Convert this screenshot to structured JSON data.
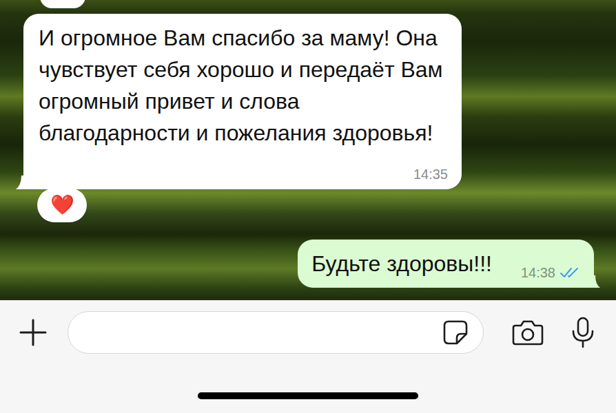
{
  "messages": [
    {
      "direction": "incoming",
      "text": "И огромное Вам спасибо за маму! Она чувствует себя хорошо и передаёт Вам огромный привет и слова благодарности и пожелания здоровья!",
      "time": "14:35",
      "reaction": "❤️"
    },
    {
      "direction": "outgoing",
      "text": "Будьте здоровы!!!",
      "time": "14:38",
      "read": true
    }
  ]
}
